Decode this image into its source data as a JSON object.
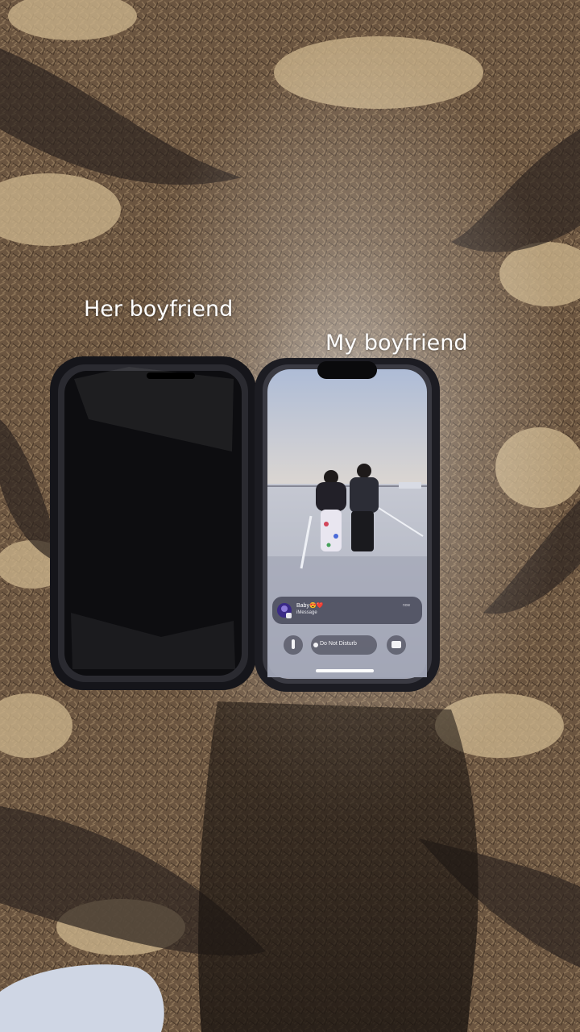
{
  "captions": {
    "left": "Her boyfriend",
    "right": "My boyfriend"
  },
  "lock_screen": {
    "notification_title": "Baby😍❤️",
    "notification_subtitle": "iMessage",
    "notification_time": "now",
    "focus_label": "Do Not Disturb",
    "icons": [
      "flashlight-icon",
      "moon-icon",
      "camera-icon"
    ]
  },
  "colors": {
    "carpet_base": "#6b5540",
    "carpet_light": "#c9b28a",
    "carpet_dark": "#2c2420",
    "phone_frame": "#1c1c22",
    "sky_top": "#aebcd6",
    "sky_horizon": "#e89b5c"
  }
}
